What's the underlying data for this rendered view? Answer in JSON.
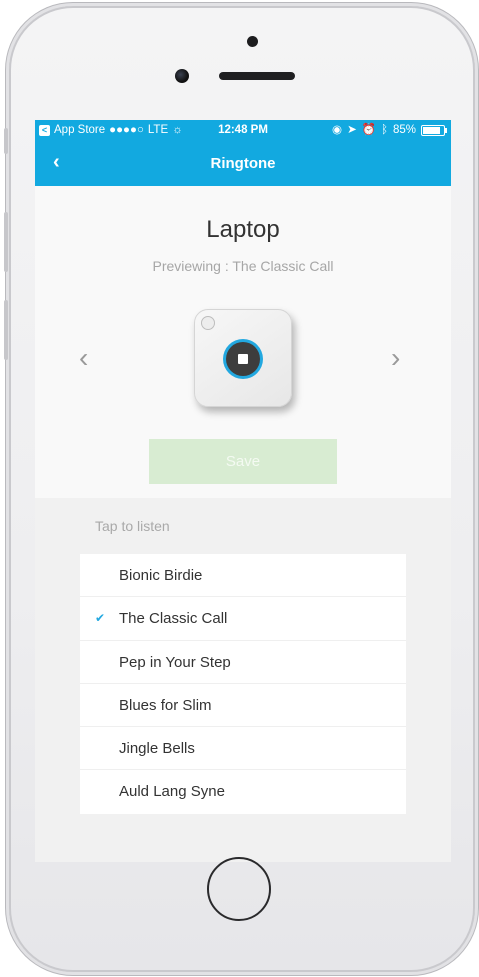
{
  "status_bar": {
    "back_app": "App Store",
    "signal": "●●●●○",
    "network": "LTE",
    "time": "12:48 PM",
    "battery": "85%"
  },
  "nav": {
    "back_icon": "chevron-left",
    "title": "Ringtone"
  },
  "device": {
    "name": "Laptop",
    "preview": "Previewing : The Classic Call",
    "playing": true
  },
  "save_label": "Save",
  "list_header": "Tap to listen",
  "ringtones": [
    {
      "label": "Bionic Birdie",
      "selected": false
    },
    {
      "label": "The Classic Call",
      "selected": true
    },
    {
      "label": "Pep in Your Step",
      "selected": false
    },
    {
      "label": "Blues for Slim",
      "selected": false
    },
    {
      "label": "Jingle Bells",
      "selected": false
    },
    {
      "label": "Auld Lang Syne",
      "selected": false
    }
  ],
  "colors": {
    "accent": "#12a9e0",
    "save_disabled": "#d8ecd2"
  }
}
